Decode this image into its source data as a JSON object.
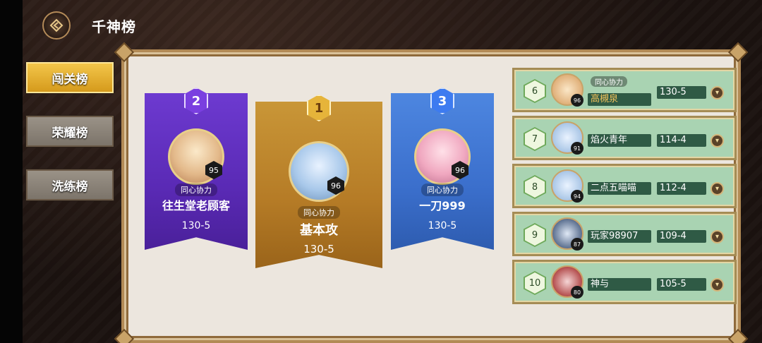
{
  "header": {
    "title": "千神榜"
  },
  "tabs": [
    {
      "label": "闯关榜",
      "active": true
    },
    {
      "label": "荣耀榜",
      "active": false
    },
    {
      "label": "洗练榜",
      "active": false
    }
  ],
  "podium": {
    "first": {
      "rank": "1",
      "level": "96",
      "guild": "同心协力",
      "name": "基本攻",
      "score": "130-5"
    },
    "second": {
      "rank": "2",
      "level": "95",
      "guild": "同心协力",
      "name": "往生堂老顾客",
      "score": "130-5"
    },
    "third": {
      "rank": "3",
      "level": "96",
      "guild": "同心协力",
      "name": "一刀999",
      "score": "130-5"
    }
  },
  "rows": [
    {
      "rank": "6",
      "level": "96",
      "guild": "同心协力",
      "name": "高槻泉",
      "score": "130-5"
    },
    {
      "rank": "7",
      "level": "91",
      "guild": "",
      "name": "焰火青年",
      "score": "114-4"
    },
    {
      "rank": "8",
      "level": "94",
      "guild": "",
      "name": "二点五喵喵",
      "score": "112-4"
    },
    {
      "rank": "9",
      "level": "87",
      "guild": "",
      "name": "玩家98907",
      "score": "109-4"
    },
    {
      "rank": "10",
      "level": "80",
      "guild": "",
      "name": "神与",
      "score": "105-5"
    }
  ],
  "colors": {
    "gold": "#d59a1c",
    "purple": "#5a2ab5",
    "blue": "#3b6fcc",
    "rowGreen": "#a9d3b2"
  },
  "icons": {
    "back": "back-arrow-icon",
    "expand": "chevron-down-icon"
  }
}
